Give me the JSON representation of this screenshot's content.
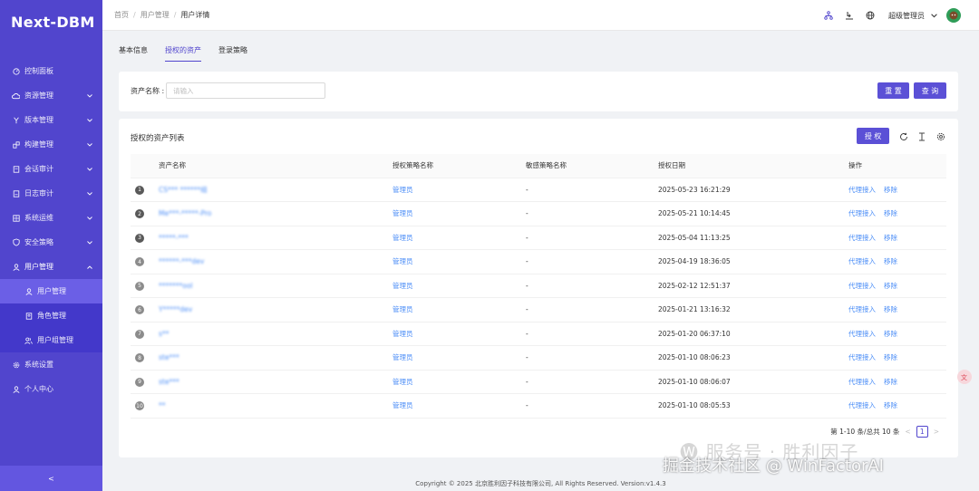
{
  "app": {
    "logo": "Next-DBM"
  },
  "sidebar": {
    "items": [
      {
        "label": "控制面板",
        "icon": "dashboard-icon",
        "has_caret": false
      },
      {
        "label": "资源管理",
        "icon": "cloud-icon",
        "has_caret": true
      },
      {
        "label": "版本管理",
        "icon": "branch-icon",
        "has_caret": true
      },
      {
        "label": "构建管理",
        "icon": "build-icon",
        "has_caret": true
      },
      {
        "label": "会话审计",
        "icon": "audit-icon",
        "has_caret": true
      },
      {
        "label": "日志审计",
        "icon": "log-icon",
        "has_caret": true
      },
      {
        "label": "系统运维",
        "icon": "ops-icon",
        "has_caret": true
      },
      {
        "label": "安全策略",
        "icon": "shield-icon",
        "has_caret": true
      },
      {
        "label": "用户管理",
        "icon": "user-icon",
        "has_caret": true,
        "open": true
      }
    ],
    "subitems": [
      {
        "label": "用户管理",
        "active": true
      },
      {
        "label": "角色管理",
        "active": false
      },
      {
        "label": "用户组管理",
        "active": false
      }
    ],
    "bottom_items": [
      {
        "label": "系统设置"
      },
      {
        "label": "个人中心"
      }
    ],
    "collapse_glyph": "<"
  },
  "header": {
    "breadcrumb": [
      "首页",
      "用户管理",
      "用户详情"
    ],
    "separator": "/",
    "user_name": "超级管理员"
  },
  "tabs": [
    {
      "label": "基本信息",
      "active": false
    },
    {
      "label": "授权的资产",
      "active": true
    },
    {
      "label": "登录策略",
      "active": false
    }
  ],
  "search": {
    "label": "资产名称 :",
    "placeholder": "请输入",
    "reset_label": "重 置",
    "query_label": "查 询"
  },
  "table": {
    "title": "授权的资产列表",
    "authorize_label": "授 权",
    "columns": [
      "资产名称",
      "授权策略名称",
      "敏感策略名称",
      "授权日期",
      "操作"
    ],
    "rows": [
      {
        "idx": "1",
        "name": "CS*** ******组",
        "strategy": "管理员",
        "sensitive": "-",
        "date": "2025-05-23 16:21:29"
      },
      {
        "idx": "2",
        "name": "Me***-*****-Pro",
        "strategy": "管理员",
        "sensitive": "-",
        "date": "2025-05-21 10:14:45"
      },
      {
        "idx": "3",
        "name": "*****-***",
        "strategy": "管理员",
        "sensitive": "-",
        "date": "2025-05-04 11:13:25"
      },
      {
        "idx": "4",
        "name": "******-***dev",
        "strategy": "管理员",
        "sensitive": "-",
        "date": "2025-04-19 18:36:05"
      },
      {
        "idx": "5",
        "name": "*******ool",
        "strategy": "管理员",
        "sensitive": "-",
        "date": "2025-02-12 12:51:37"
      },
      {
        "idx": "6",
        "name": "Y*****dev",
        "strategy": "管理员",
        "sensitive": "-",
        "date": "2025-01-21 13:16:32"
      },
      {
        "idx": "7",
        "name": "s**",
        "strategy": "管理员",
        "sensitive": "-",
        "date": "2025-01-20 06:37:10"
      },
      {
        "idx": "8",
        "name": "ste***",
        "strategy": "管理员",
        "sensitive": "-",
        "date": "2025-01-10 08:06:23"
      },
      {
        "idx": "9",
        "name": "ste***",
        "strategy": "管理员",
        "sensitive": "-",
        "date": "2025-01-10 08:06:07"
      },
      {
        "idx": "10",
        "name": "**",
        "strategy": "管理员",
        "sensitive": "-",
        "date": "2025-01-10 08:05:53"
      }
    ],
    "op_proxy": "代理接入",
    "op_remove": "移除"
  },
  "pagination": {
    "summary": "第 1-10 条/总共 10 条",
    "prev": "<",
    "next": ">",
    "current_page": "1"
  },
  "footer": {
    "copyright": "Copyright © 2025 北京胜利因子科技有限公司, All Rights Reserved. Version:v1.4.3"
  },
  "watermark": {
    "line1": "🅦 服务号 · 胜利因子",
    "line2": "掘金技术社区 @ WinFactorAI"
  },
  "colors": {
    "sidebar": "#5145cd",
    "accent": "#5b50d6",
    "link": "#4c8ef7"
  }
}
